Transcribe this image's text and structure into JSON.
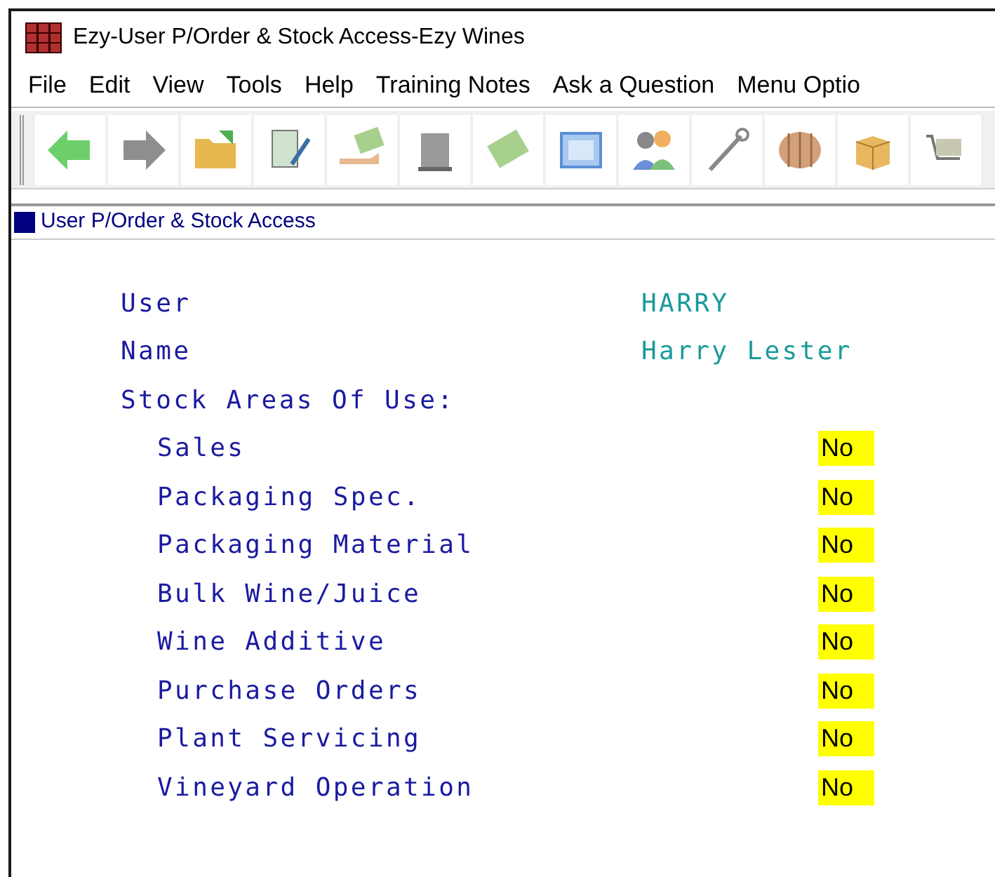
{
  "window": {
    "title": "Ezy-User P/Order & Stock Access-Ezy Wines"
  },
  "menu": [
    "File",
    "Edit",
    "View",
    "Tools",
    "Help",
    "Training Notes",
    "Ask a Question",
    "Menu Optio"
  ],
  "subwindow": {
    "title": "User P/Order & Stock Access"
  },
  "fields": [
    {
      "label": "User",
      "value": "HARRY"
    },
    {
      "label": "Name",
      "value": "Harry Lester"
    }
  ],
  "section": {
    "label": "Stock Areas Of Use:"
  },
  "areas": [
    {
      "label": "Sales",
      "value": "No"
    },
    {
      "label": "Packaging Spec.",
      "value": "No"
    },
    {
      "label": "Packaging Material",
      "value": "No"
    },
    {
      "label": "Bulk Wine/Juice",
      "value": "No"
    },
    {
      "label": "Wine Additive",
      "value": "No"
    },
    {
      "label": "Purchase Orders",
      "value": "No"
    },
    {
      "label": "Plant Servicing",
      "value": "No"
    },
    {
      "label": "Vineyard Operation",
      "value": "No"
    }
  ]
}
